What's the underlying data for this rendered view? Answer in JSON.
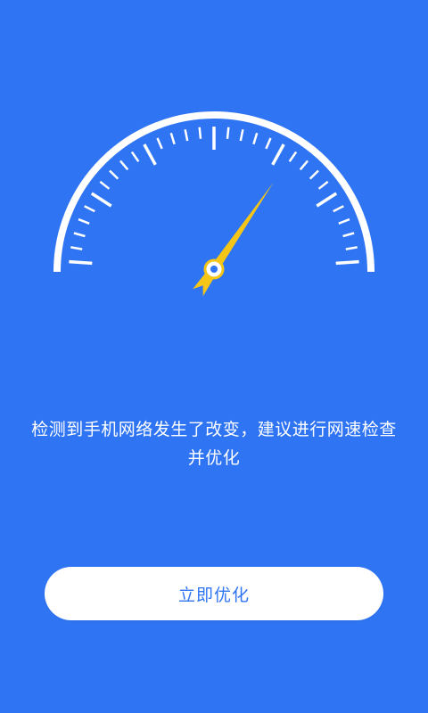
{
  "colors": {
    "background": "#2f74f2",
    "gauge_stroke": "#ffffff",
    "needle": "#f5c518",
    "button_bg": "#ffffff",
    "button_text": "#2f74f2"
  },
  "gauge": {
    "needle_level": 0.7
  },
  "message": {
    "text": "检测到手机网络发生了改变，建议进行网速检查并优化"
  },
  "actions": {
    "optimize_label": "立即优化"
  }
}
